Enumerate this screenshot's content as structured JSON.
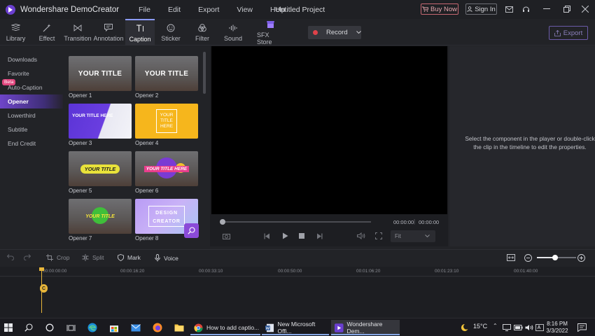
{
  "titlebar": {
    "app_name": "Wondershare DemoCreator",
    "menu": [
      "File",
      "Edit",
      "Export",
      "View",
      "Help"
    ],
    "project_title": "Untitled Project",
    "buy_now": "Buy Now",
    "sign_in": "Sign In"
  },
  "toolbar": {
    "tabs": [
      {
        "label": "Library",
        "icon": "library-icon"
      },
      {
        "label": "Effect",
        "icon": "effect-wand-icon"
      },
      {
        "label": "Transition",
        "icon": "transition-icon"
      },
      {
        "label": "Annotation",
        "icon": "annotation-icon"
      },
      {
        "label": "Caption",
        "icon": "caption-icon",
        "active": true
      },
      {
        "label": "Sticker",
        "icon": "sticker-icon"
      },
      {
        "label": "Filter",
        "icon": "filter-icon"
      },
      {
        "label": "Sound",
        "icon": "sound-icon"
      },
      {
        "label": "SFX Store",
        "icon": "sfx-store-icon"
      }
    ],
    "record_label": "Record",
    "export_label": "Export"
  },
  "sidebar": {
    "items": [
      "Downloads",
      "Favorite",
      "Auto-Caption",
      "Opener",
      "Lowerthird",
      "Subtitle",
      "End Credit"
    ],
    "active": "Opener",
    "beta_badge": "Beta"
  },
  "templates": {
    "cards": [
      {
        "name": "Opener 1",
        "thumb_text": "YOUR TITLE"
      },
      {
        "name": "Opener 2",
        "thumb_text": "YOUR TITLE"
      },
      {
        "name": "Opener 3",
        "thumb_text": "YOUR TITLE HERE"
      },
      {
        "name": "Opener 4",
        "thumb_text": "YOUR TITLE HERE"
      },
      {
        "name": "Opener 5",
        "thumb_text": "YOUR TITLE"
      },
      {
        "name": "Opener 6",
        "thumb_text": "YOUR TITLE HERE"
      },
      {
        "name": "Opener 7",
        "thumb_text": "YOUR TITLE"
      },
      {
        "name": "Opener 8",
        "thumb_text": "DESIGN CREATOR"
      }
    ]
  },
  "player": {
    "current_time": "00:00:00",
    "total_time": "00:00:00",
    "fit_label": "Fit"
  },
  "properties": {
    "hint": "Select the component in the player or double-click the clip in the timeline to edit the properties."
  },
  "timeline": {
    "tools": [
      "Crop",
      "Split",
      "Mark",
      "Voice"
    ],
    "ruler": [
      "00:00:00:00",
      "00:00:16:20",
      "00:00:33:10",
      "00:00:50:00",
      "00:01:06:20",
      "00:01:23:10",
      "00:01:40:00"
    ],
    "zoom_level": 0.46
  },
  "taskbar": {
    "apps": [
      "How to add captio...",
      "New Microsoft Offi...",
      "Wondershare Dem..."
    ],
    "temperature": "15°C",
    "time": "8:16 PM",
    "date": "3/3/2022"
  },
  "colors": {
    "accent": "#8c9bff",
    "brand_purple": "#6e45c9",
    "record_red": "#e0424a",
    "playhead": "#e8b63a"
  }
}
